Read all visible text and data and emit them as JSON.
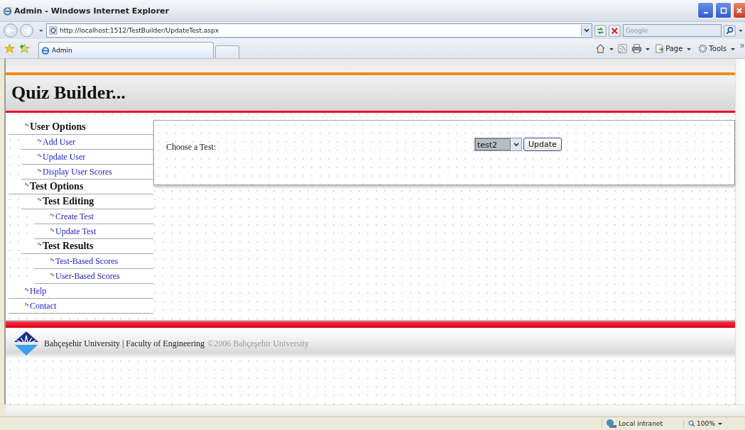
{
  "window": {
    "title": "Admin - Windows Internet Explorer"
  },
  "address_bar": {
    "url": "http://localhost:1512/TestBuilder/UpdateTest.aspx",
    "search_placeholder": "Google"
  },
  "tabs": [
    {
      "label": "Admin",
      "selected": true
    }
  ],
  "command_bar": {
    "page": "Page",
    "tools": "Tools"
  },
  "site": {
    "title": "Quiz Builder..."
  },
  "menu": [
    {
      "label": "User Options",
      "kind": "heading",
      "children": [
        {
          "label": "Add User",
          "kind": "link"
        },
        {
          "label": "Update User",
          "kind": "link"
        },
        {
          "label": "Display User Scores",
          "kind": "link"
        }
      ]
    },
    {
      "label": "Test Options",
      "kind": "heading",
      "children": [
        {
          "label": "Test Editing",
          "kind": "heading",
          "children": [
            {
              "label": "Create Test",
              "kind": "link"
            },
            {
              "label": "Update Test",
              "kind": "link"
            }
          ]
        },
        {
          "label": "Test Results",
          "kind": "heading",
          "children": [
            {
              "label": "Test-Based Scores",
              "kind": "link"
            },
            {
              "label": "User-Based Scores",
              "kind": "link"
            }
          ]
        }
      ]
    },
    {
      "label": "Help",
      "kind": "link"
    },
    {
      "label": "Contact",
      "kind": "link"
    }
  ],
  "form": {
    "label": "Choose a Test:",
    "value": "test2",
    "button": "Update"
  },
  "footer": {
    "text": "Bahçeşehir University | Faculty of Engineering",
    "copyright": "©2006 Bahçeşehir University"
  },
  "status_bar": {
    "zone": "Local intranet",
    "zoom": "100%"
  }
}
